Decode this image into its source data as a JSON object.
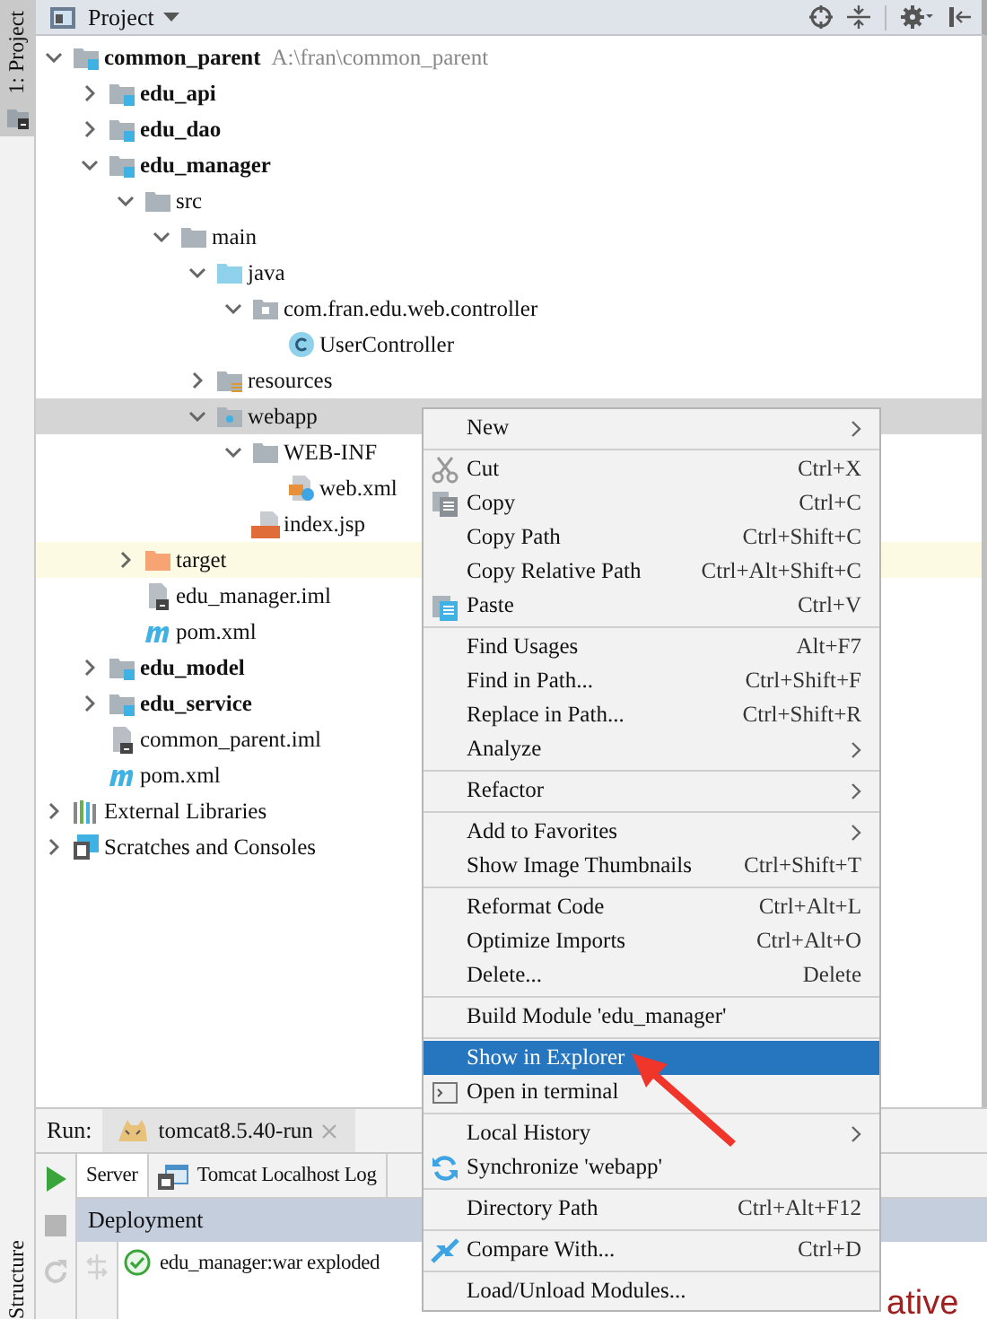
{
  "side_tabs": [
    {
      "label": "1: Project",
      "selected": true
    },
    {
      "label": "Structure",
      "selected": false
    }
  ],
  "project_header": {
    "title": "Project"
  },
  "tree": [
    {
      "name": "common_parent",
      "kind": "module",
      "bold": true,
      "path": "A:\\fran\\common_parent",
      "expanded": true,
      "selected": false,
      "hovered": false,
      "children": [
        {
          "name": "edu_api",
          "kind": "module",
          "bold": true,
          "expanded": false,
          "selected": false,
          "hovered": false
        },
        {
          "name": "edu_dao",
          "kind": "module",
          "bold": true,
          "expanded": false,
          "selected": false,
          "hovered": false
        },
        {
          "name": "edu_manager",
          "kind": "module",
          "bold": true,
          "expanded": true,
          "selected": false,
          "hovered": false,
          "children": [
            {
              "name": "src",
              "kind": "folder",
              "bold": false,
              "expanded": true,
              "selected": false,
              "hovered": false,
              "children": [
                {
                  "name": "main",
                  "kind": "folder",
                  "bold": false,
                  "expanded": true,
                  "selected": false,
                  "hovered": false,
                  "children": [
                    {
                      "name": "java",
                      "kind": "source-folder",
                      "bold": false,
                      "expanded": true,
                      "selected": false,
                      "hovered": false,
                      "children": [
                        {
                          "name": "com.fran.edu.web.controller",
                          "kind": "package",
                          "bold": false,
                          "expanded": true,
                          "selected": false,
                          "hovered": false,
                          "children": [
                            {
                              "name": "UserController",
                              "kind": "class",
                              "bold": false,
                              "selected": false,
                              "hovered": false
                            }
                          ]
                        }
                      ]
                    },
                    {
                      "name": "resources",
                      "kind": "resources-folder",
                      "bold": false,
                      "expanded": false,
                      "selected": false,
                      "hovered": false
                    },
                    {
                      "name": "webapp",
                      "kind": "web-folder",
                      "bold": false,
                      "expanded": true,
                      "selected": true,
                      "hovered": false,
                      "children": [
                        {
                          "name": "WEB-INF",
                          "kind": "folder",
                          "bold": false,
                          "expanded": true,
                          "selected": false,
                          "hovered": false,
                          "children": [
                            {
                              "name": "web.xml",
                              "kind": "xml",
                              "bold": false,
                              "selected": false,
                              "hovered": false
                            }
                          ]
                        },
                        {
                          "name": "index.jsp",
                          "kind": "jsp",
                          "bold": false,
                          "selected": false,
                          "hovered": false
                        }
                      ]
                    }
                  ]
                }
              ]
            },
            {
              "name": "target",
              "kind": "excluded-folder",
              "bold": false,
              "expanded": false,
              "selected": false,
              "hovered": true
            },
            {
              "name": "edu_manager.iml",
              "kind": "iml",
              "bold": false,
              "selected": false,
              "hovered": false
            },
            {
              "name": "pom.xml",
              "kind": "maven",
              "bold": false,
              "selected": false,
              "hovered": false
            }
          ]
        },
        {
          "name": "edu_model",
          "kind": "module",
          "bold": true,
          "expanded": false,
          "selected": false,
          "hovered": false
        },
        {
          "name": "edu_service",
          "kind": "module",
          "bold": true,
          "expanded": false,
          "selected": false,
          "hovered": false
        },
        {
          "name": "common_parent.iml",
          "kind": "iml",
          "bold": false,
          "selected": false,
          "hovered": false
        },
        {
          "name": "pom.xml",
          "kind": "maven",
          "bold": false,
          "selected": false,
          "hovered": false
        }
      ]
    },
    {
      "name": "External Libraries",
      "kind": "libraries",
      "bold": false,
      "expanded": false,
      "selected": false,
      "hovered": false
    },
    {
      "name": "Scratches and Consoles",
      "kind": "scratches",
      "bold": false,
      "expanded": false,
      "selected": false,
      "hovered": false
    }
  ],
  "run_panel": {
    "label": "Run:",
    "tabs": [
      {
        "label": "tomcat8.5.40-run",
        "selected": true
      }
    ],
    "sub_tabs": [
      {
        "label": "Server",
        "selected": true,
        "kind": "plain"
      },
      {
        "label": "Tomcat Localhost Log",
        "selected": false,
        "kind": "log"
      }
    ],
    "deployment_header": "Deployment",
    "deployments": [
      {
        "name": "edu_manager:war exploded",
        "deployed": true
      }
    ]
  },
  "editor_fragment": "ative",
  "context_menu": {
    "groups": [
      [
        {
          "label": "New",
          "submenu": true,
          "kind": "plain",
          "selected": false
        }
      ],
      [
        {
          "label": "Cut",
          "shortcut": "Ctrl+X",
          "submenu": false,
          "kind": "cut",
          "selected": false
        },
        {
          "label": "Copy",
          "shortcut": "Ctrl+C",
          "submenu": false,
          "kind": "copy",
          "selected": false
        },
        {
          "label": "Copy Path",
          "shortcut": "Ctrl+Shift+C",
          "submenu": false,
          "kind": "plain",
          "selected": false
        },
        {
          "label": "Copy Relative Path",
          "shortcut": "Ctrl+Alt+Shift+C",
          "submenu": false,
          "kind": "plain",
          "selected": false
        },
        {
          "label": "Paste",
          "shortcut": "Ctrl+V",
          "submenu": false,
          "kind": "paste",
          "selected": false
        }
      ],
      [
        {
          "label": "Find Usages",
          "shortcut": "Alt+F7",
          "submenu": false,
          "kind": "plain",
          "selected": false
        },
        {
          "label": "Find in Path...",
          "shortcut": "Ctrl+Shift+F",
          "submenu": false,
          "kind": "plain",
          "selected": false
        },
        {
          "label": "Replace in Path...",
          "shortcut": "Ctrl+Shift+R",
          "submenu": false,
          "kind": "plain",
          "selected": false
        },
        {
          "label": "Analyze",
          "submenu": true,
          "kind": "plain",
          "selected": false
        }
      ],
      [
        {
          "label": "Refactor",
          "submenu": true,
          "kind": "plain",
          "selected": false
        }
      ],
      [
        {
          "label": "Add to Favorites",
          "submenu": true,
          "kind": "plain",
          "selected": false
        },
        {
          "label": "Show Image Thumbnails",
          "shortcut": "Ctrl+Shift+T",
          "submenu": false,
          "kind": "plain",
          "selected": false
        }
      ],
      [
        {
          "label": "Reformat Code",
          "shortcut": "Ctrl+Alt+L",
          "submenu": false,
          "kind": "plain",
          "selected": false
        },
        {
          "label": "Optimize Imports",
          "shortcut": "Ctrl+Alt+O",
          "submenu": false,
          "kind": "plain",
          "selected": false
        },
        {
          "label": "Delete...",
          "shortcut": "Delete",
          "submenu": false,
          "kind": "plain",
          "selected": false
        }
      ],
      [
        {
          "label": "Build Module 'edu_manager'",
          "submenu": false,
          "kind": "plain",
          "selected": false
        }
      ],
      [
        {
          "label": "Show in Explorer",
          "submenu": false,
          "kind": "plain",
          "selected": true
        },
        {
          "label": "Open in terminal",
          "submenu": false,
          "kind": "terminal",
          "selected": false
        }
      ],
      [
        {
          "label": "Local History",
          "submenu": true,
          "kind": "plain",
          "selected": false
        },
        {
          "label": "Synchronize 'webapp'",
          "submenu": false,
          "kind": "sync",
          "selected": false
        }
      ],
      [
        {
          "label": "Directory Path",
          "shortcut": "Ctrl+Alt+F12",
          "submenu": false,
          "kind": "plain",
          "selected": false
        }
      ],
      [
        {
          "label": "Compare With...",
          "shortcut": "Ctrl+D",
          "submenu": false,
          "kind": "compare",
          "selected": false
        }
      ],
      [
        {
          "label": "Load/Unload Modules...",
          "submenu": false,
          "kind": "plain",
          "selected": false
        }
      ]
    ]
  }
}
